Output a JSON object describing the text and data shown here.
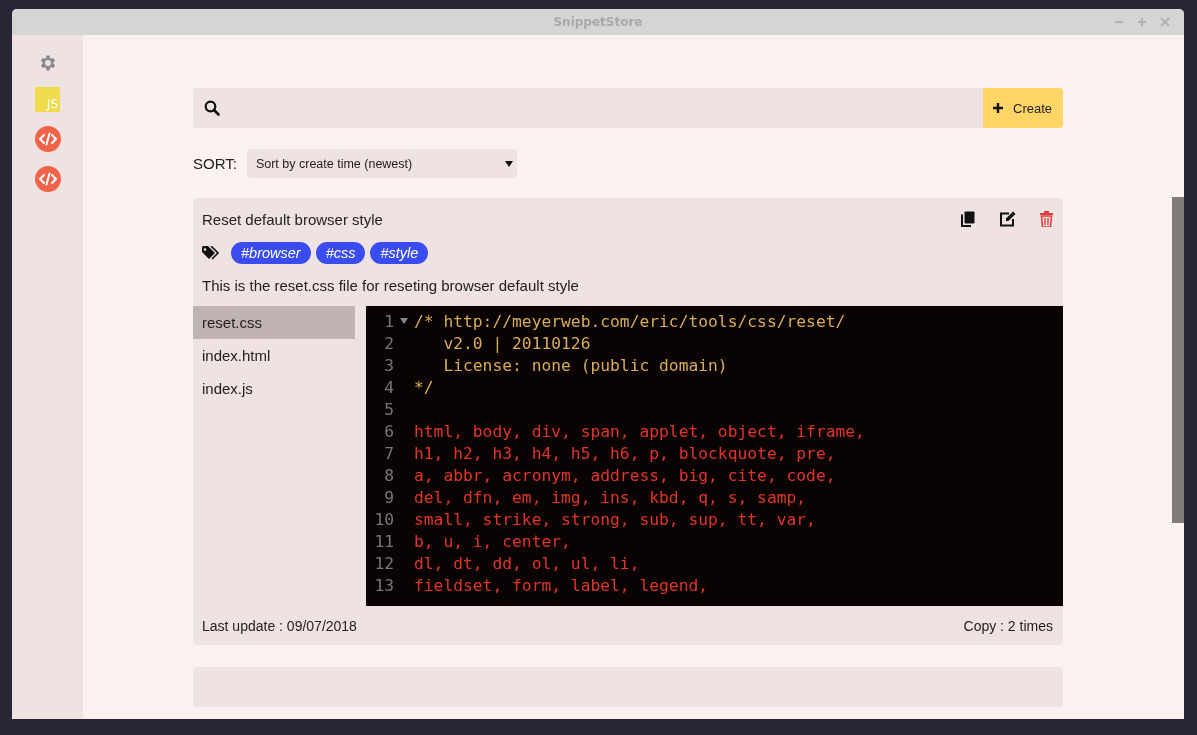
{
  "window": {
    "title": "SnippetStore"
  },
  "sidebar": {
    "items": [
      {
        "kind": "settings"
      },
      {
        "kind": "language",
        "label": "JS"
      },
      {
        "kind": "code"
      },
      {
        "kind": "code"
      }
    ]
  },
  "search": {
    "button": "Create"
  },
  "sort": {
    "label": "SORT:",
    "value": "Sort by create time (newest)"
  },
  "snippet": {
    "title": "Reset default browser style",
    "tags": [
      "#browser",
      "#css",
      "#style"
    ],
    "description": "This is the reset.css file for reseting browser default style",
    "files": [
      {
        "name": "reset.css",
        "selected": true
      },
      {
        "name": "index.html",
        "selected": false
      },
      {
        "name": "index.js",
        "selected": false
      }
    ],
    "code": [
      {
        "number": "1",
        "text": "/* http://meyerweb.com/eric/tools/css/reset/",
        "kind": "comment",
        "foldable": true
      },
      {
        "number": "2",
        "text": "   v2.0 | 20110126",
        "kind": "comment"
      },
      {
        "number": "3",
        "text": "   License: none (public domain)",
        "kind": "comment"
      },
      {
        "number": "4",
        "text": "*/",
        "kind": "comment"
      },
      {
        "number": "5"
      },
      {
        "number": "6",
        "text": "html, body, div, span, applet, object, iframe,",
        "kind": "code"
      },
      {
        "number": "7",
        "text": "h1, h2, h3, h4, h5, h6, p, blockquote, pre,",
        "kind": "code"
      },
      {
        "number": "8",
        "text": "a, abbr, acronym, address, big, cite, code,",
        "kind": "code"
      },
      {
        "number": "9",
        "text": "del, dfn, em, img, ins, kbd, q, s, samp,",
        "kind": "code"
      },
      {
        "number": "10",
        "text": "small, strike, strong, sub, sup, tt, var,",
        "kind": "code"
      },
      {
        "number": "11",
        "text": "b, u, i, center,",
        "kind": "code"
      },
      {
        "number": "12",
        "text": "dl, dt, dd, ol, ul, li,",
        "kind": "code"
      },
      {
        "number": "13",
        "text": "fieldset, form, label, legend,",
        "kind": "code"
      }
    ],
    "last_update": "Last update : 09/07/2018",
    "copy_count": "Copy : 2 times"
  }
}
